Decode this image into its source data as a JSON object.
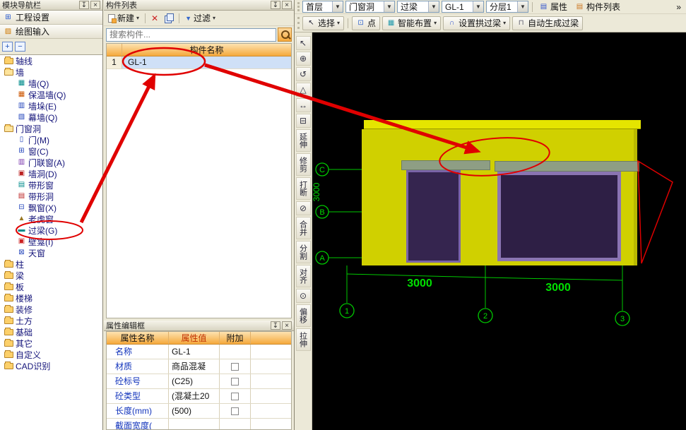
{
  "left_panel": {
    "title": "模块导航栏",
    "nav_buttons": [
      "工程设置",
      "绘图输入"
    ],
    "tree": [
      {
        "label": "轴线",
        "icon": "folder-icon"
      },
      {
        "label": "墙",
        "icon": "folder-open-icon"
      },
      {
        "label": "墙(Q)",
        "icon": "wall-icon"
      },
      {
        "label": "保温墙(Q)",
        "icon": "insulation-wall-icon"
      },
      {
        "label": "墙垛(E)",
        "icon": "wall-pier-icon"
      },
      {
        "label": "幕墙(Q)",
        "icon": "curtain-wall-icon"
      },
      {
        "label": "门窗洞",
        "icon": "folder-open-icon"
      },
      {
        "label": "门(M)",
        "icon": "door-icon"
      },
      {
        "label": "窗(C)",
        "icon": "window-icon"
      },
      {
        "label": "门联窗(A)",
        "icon": "door-window-icon"
      },
      {
        "label": "墙洞(D)",
        "icon": "wall-hole-icon"
      },
      {
        "label": "带形窗",
        "icon": "strip-window-icon"
      },
      {
        "label": "带形洞",
        "icon": "strip-hole-icon"
      },
      {
        "label": "飘窗(X)",
        "icon": "bay-window-icon"
      },
      {
        "label": "老虎窗",
        "icon": "dormer-window-icon"
      },
      {
        "label": "过梁(G)",
        "icon": "lintel-icon"
      },
      {
        "label": "壁龛(I)",
        "icon": "niche-icon"
      },
      {
        "label": "天窗",
        "icon": "skylight-icon"
      },
      {
        "label": "柱",
        "icon": "folder-icon"
      },
      {
        "label": "梁",
        "icon": "folder-icon"
      },
      {
        "label": "板",
        "icon": "folder-icon"
      },
      {
        "label": "楼梯",
        "icon": "folder-icon"
      },
      {
        "label": "装修",
        "icon": "folder-icon"
      },
      {
        "label": "土方",
        "icon": "folder-icon"
      },
      {
        "label": "基础",
        "icon": "folder-icon"
      },
      {
        "label": "其它",
        "icon": "folder-icon"
      },
      {
        "label": "自定义",
        "icon": "folder-icon"
      },
      {
        "label": "CAD识别",
        "icon": "folder-icon"
      }
    ]
  },
  "component_panel": {
    "title": "构件列表",
    "new_button": "新建",
    "filter_button": "过滤",
    "search_placeholder": "搜索构件...",
    "name_header": "构件名称",
    "rows": [
      {
        "index": "1",
        "name": "GL-1"
      }
    ]
  },
  "property_panel": {
    "title": "属性编辑框",
    "headers": {
      "name": "属性名称",
      "value": "属性值",
      "attach": "附加"
    },
    "rows": [
      {
        "name": "名称",
        "value": "GL-1"
      },
      {
        "name": "材质",
        "value": "商品混凝"
      },
      {
        "name": "砼标号",
        "value": "(C25)"
      },
      {
        "name": "砼类型",
        "value": "(混凝土20"
      },
      {
        "name": "长度(mm)",
        "value": "(500)"
      },
      {
        "name": "截面宽度(",
        "value": ""
      }
    ]
  },
  "top_toolbar": {
    "combos": [
      "首层",
      "门窗洞",
      "过梁",
      "GL-1",
      "分层1"
    ],
    "attributes_button": "属性",
    "component_list_button": "构件列表",
    "overflow": "»"
  },
  "draw_toolbar": {
    "select": "选择",
    "point": "点",
    "smart_layout": "智能布置",
    "set_arch_lintel": "设置拱过梁",
    "auto_generate_lintel": "自动生成过梁"
  },
  "side_toolbar": {
    "labels": [
      "延伸",
      "修剪",
      "打断",
      "合并",
      "分割",
      "对齐",
      "偏移",
      "拉伸"
    ]
  },
  "viewport": {
    "row_axes": [
      "C",
      "B",
      "A"
    ],
    "col_axes": [
      "1",
      "2",
      "3"
    ],
    "span_dimensions": [
      "3000",
      "3000"
    ],
    "height_dimension": "3000"
  },
  "colors": {
    "header_orange": "#f5a93c",
    "selection_blue": "#cfe0f7",
    "wall_yellow": "#d0d000",
    "opening_purple": "#35254f",
    "lintel_gray_green": "#8e9e84",
    "axis_green": "#00c800",
    "annotation_red": "#e00000"
  }
}
